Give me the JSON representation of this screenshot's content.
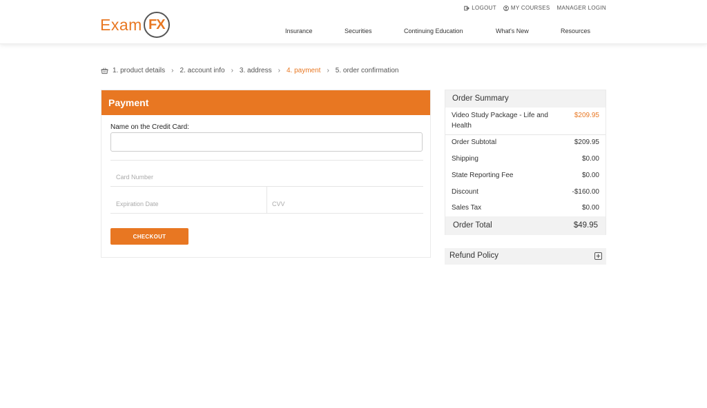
{
  "logo": {
    "part1": "Exam",
    "part2": "FX"
  },
  "toplinks": [
    {
      "label": "LOGOUT",
      "icon": "logout-icon"
    },
    {
      "label": "MY COURSES",
      "icon": "user-icon"
    },
    {
      "label": "MANAGER LOGIN",
      "icon": ""
    }
  ],
  "nav": [
    "Insurance",
    "Securities",
    "Continuing Education",
    "What's New",
    "Resources"
  ],
  "steps": [
    {
      "label": "1. product details",
      "active": false
    },
    {
      "label": "2. account info",
      "active": false
    },
    {
      "label": "3. address",
      "active": false
    },
    {
      "label": "4. payment",
      "active": true
    },
    {
      "label": "5. order confirmation",
      "active": false
    }
  ],
  "payment": {
    "title": "Payment",
    "name_label": "Name on the Credit Card:",
    "name_value": "",
    "card_number_placeholder": "Card Number",
    "expiration_placeholder": "Expiration Date",
    "cvv_placeholder": "CVV",
    "checkout_label": "CHECKOUT"
  },
  "summary": {
    "title": "Order Summary",
    "item_name": "Video Study Package - Life and Health",
    "item_price": "$209.95",
    "rows": [
      {
        "label": "Order Subtotal",
        "value": "$209.95"
      },
      {
        "label": "Shipping",
        "value": "$0.00"
      },
      {
        "label": "State Reporting Fee",
        "value": "$0.00"
      },
      {
        "label": "Discount",
        "value": "-$160.00"
      },
      {
        "label": "Sales Tax",
        "value": "$0.00"
      }
    ],
    "total_label": "Order Total",
    "total_value": "$49.95"
  },
  "refund": {
    "label": "Refund Policy"
  },
  "colors": {
    "accent": "#e87722",
    "panel_bg": "#f2f2f2"
  }
}
